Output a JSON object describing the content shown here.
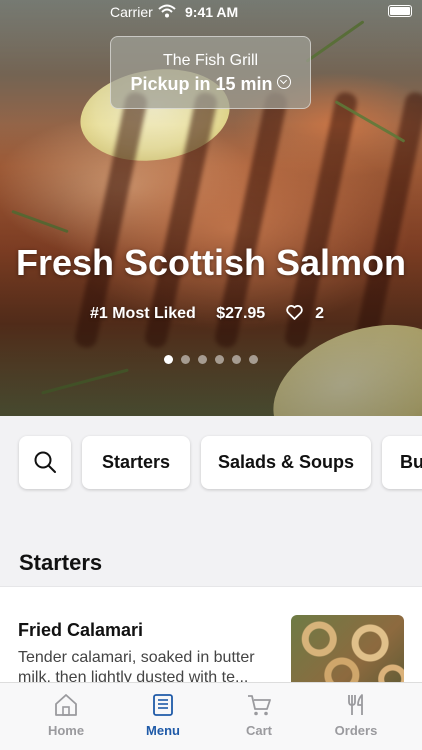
{
  "status_bar": {
    "carrier": "Carrier",
    "time": "9:41 AM"
  },
  "pickup": {
    "restaurant": "The Fish Grill",
    "timing": "Pickup in 15 min"
  },
  "featured": {
    "title": "Fresh Scottish Salmon",
    "rank": "#1 Most Liked",
    "price": "$27.95",
    "likes": "2",
    "carousel": {
      "count": 6,
      "active_index": 0
    }
  },
  "categories": [
    "Starters",
    "Salads & Soups",
    "Bu"
  ],
  "section": {
    "title": "Starters"
  },
  "items": [
    {
      "name": "Fried Calamari",
      "description": "Tender calamari, soaked in butter milk, then lightly dusted with te..."
    }
  ],
  "tabs": [
    {
      "label": "Home",
      "icon": "home-icon",
      "active": false
    },
    {
      "label": "Menu",
      "icon": "menu-icon",
      "active": true
    },
    {
      "label": "Cart",
      "icon": "cart-icon",
      "active": false
    },
    {
      "label": "Orders",
      "icon": "fork-knife-icon",
      "active": false
    }
  ],
  "colors": {
    "accent": "#1f5aa8",
    "inactive_tab": "#9a9a9e"
  }
}
